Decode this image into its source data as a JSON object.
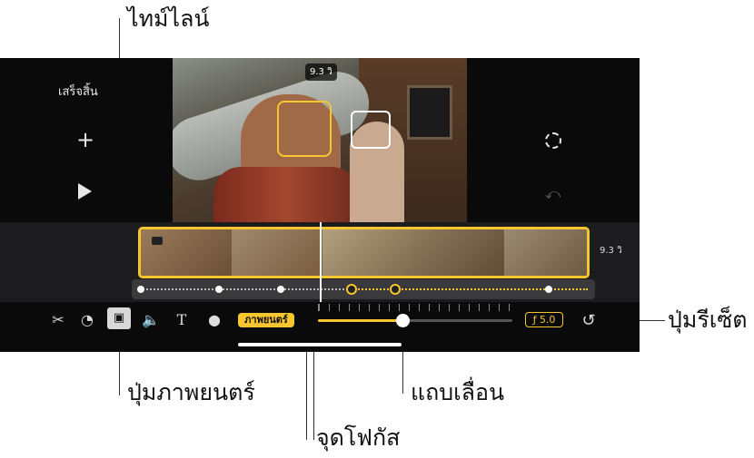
{
  "callouts": {
    "timeline": "ไทม์ไลน์",
    "cinematic_button": "ปุ่มภาพยนตร์",
    "focus_point": "จุดโฟกัส",
    "slider": "แถบเลื่อน",
    "reset_button": "ปุ่มรีเซ็ต"
  },
  "editor": {
    "done_label": "เสร็จสิ้น",
    "playhead_time": "9.3 วิ",
    "clip_duration": "9.3 วิ",
    "cinematic_label": "ภาพยนตร์",
    "aperture_value": "ƒ 5.0",
    "icons": [
      "add-icon",
      "play-icon",
      "settings-icon",
      "undo-icon",
      "scissors-icon",
      "speed-icon",
      "cinematic-icon",
      "volume-icon",
      "text-icon",
      "filters-icon",
      "reset-icon"
    ],
    "accent_color": "#f7c62f",
    "slider_level": 0.45
  }
}
